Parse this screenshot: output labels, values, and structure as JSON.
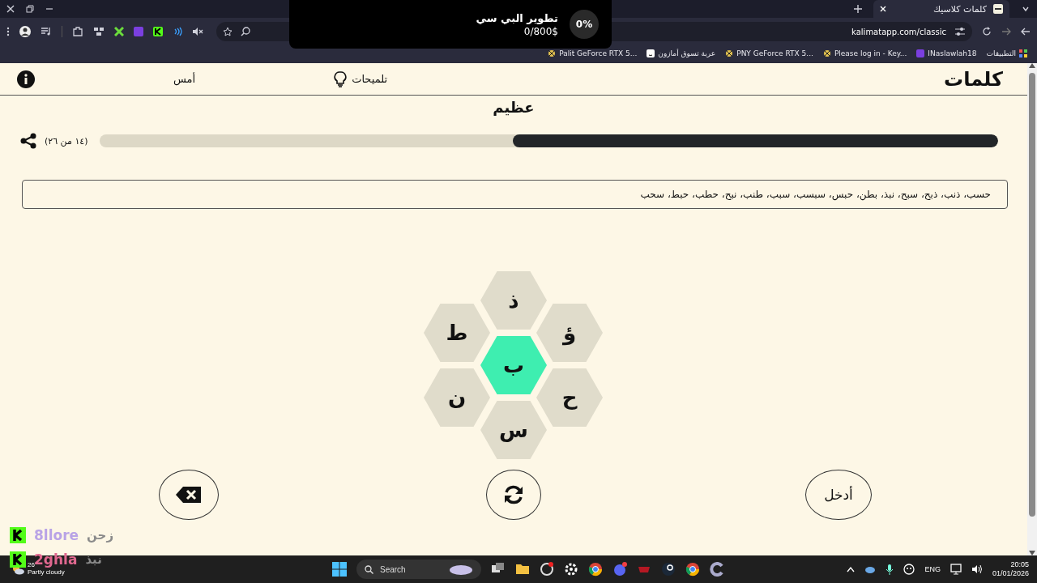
{
  "browser": {
    "tab_title": "كلمات كلاسيك",
    "url": "kalimatapp.com/classic",
    "bookmarks": [
      {
        "label": "التطبيقات"
      },
      {
        "label": "INaslawlah18"
      },
      {
        "label": "Please log in - Key..."
      },
      {
        "label": "PNY GeForce RTX 5..."
      },
      {
        "label": "عربة تسوق أمازون"
      },
      {
        "label": "Palit GeForce RTX 5..."
      }
    ]
  },
  "donation_widget": {
    "percent": "0%",
    "title": "تطوير البي سي",
    "amount": "0/800$"
  },
  "app": {
    "logo": "كلمات",
    "nav": [
      {
        "label": "تلميحات",
        "kind": "hints"
      },
      {
        "label": "أمس",
        "kind": "plain"
      }
    ],
    "rank": "عظيم",
    "progress": {
      "level": 0.54,
      "count": "(١٤ من ٢٦)"
    },
    "found_words": "حسب، ذنب، ذبح، سبح، نبذ، بطن، حبس، سبسب، سبب، طنب، نبح، حطب، حبط، سحب",
    "hexes": [
      {
        "letter": "ذ",
        "selected": false
      },
      {
        "letter": "ؤ",
        "selected": false
      },
      {
        "letter": "ط",
        "selected": false
      },
      {
        "letter": "ب",
        "selected": true
      },
      {
        "letter": "ن",
        "selected": false
      },
      {
        "letter": "ح",
        "selected": false
      },
      {
        "letter": "س",
        "selected": false
      }
    ],
    "enter_label": "أدخل"
  },
  "chat_overlay": [
    {
      "user": "8llore",
      "message": "زحن",
      "color": "#b9a3e6"
    },
    {
      "user": "2ghla",
      "message": "نبذ",
      "color": "#e0688f"
    }
  ],
  "taskbar": {
    "temperature": "26°",
    "weather": "Partly cloudy",
    "search_placeholder": "Search",
    "language": "ENG",
    "time": "20:05",
    "date": "01/01/2026"
  }
}
